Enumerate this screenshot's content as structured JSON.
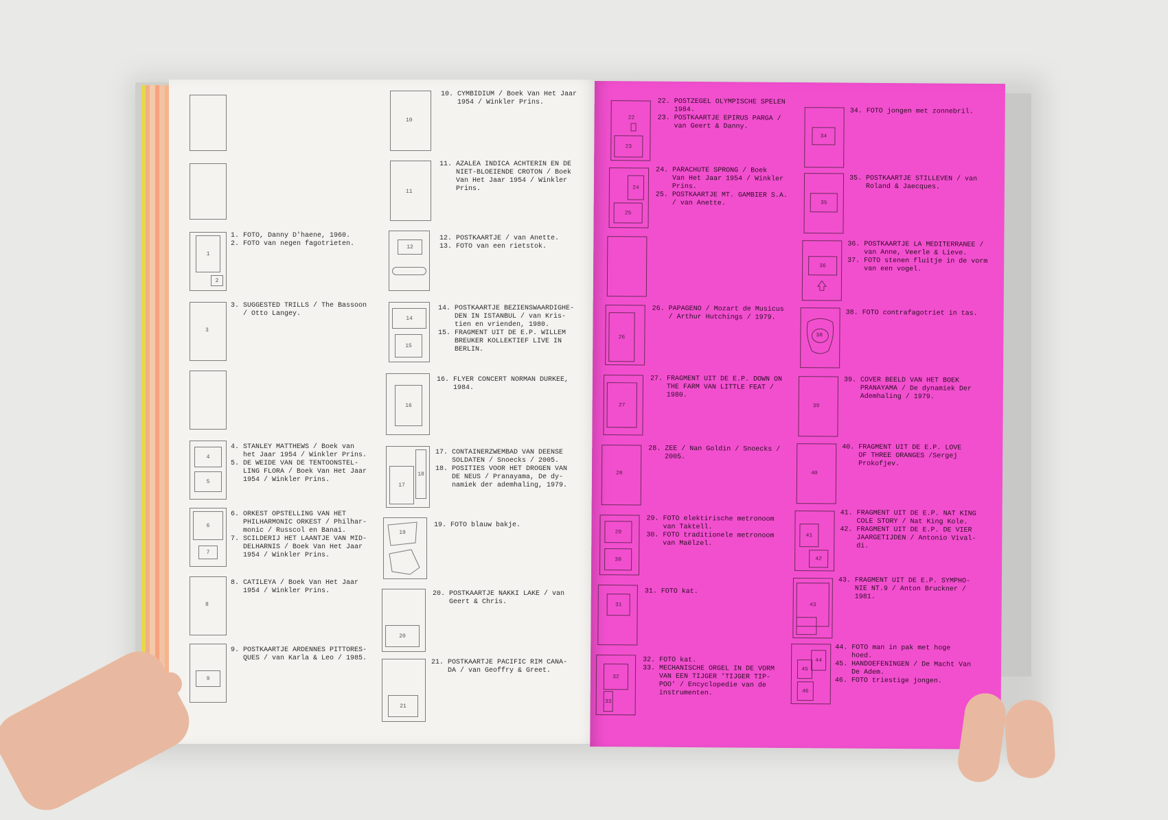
{
  "left_page": {
    "captions": {
      "c1": "1. FOTO, Danny D'haene, 1960.\n2. FOTO van negen fagotrieten.",
      "c3": "3. SUGGESTED TRILLS / The Bassoon\n   / Otto Langey.",
      "c4": "4. STANLEY MATTHEWS / Boek van\n   het Jaar 1954 / Winkler Prins.\n5. DE WEIDE VAN DE TENTOONSTEL-\n   LING FLORA / Boek Van Het Jaar\n   1954 / Winkler Prins.",
      "c6": "6. ORKEST OPSTELLING VAN HET\n   PHILHARMONIC ORKEST / Philhar-\n   monic / Russcol en Banai.\n7. SCILDERIJ HET LAANTJE VAN MID-\n   DELHARNIS / Boek Van Het Jaar\n   1954 / Winkler Prins.",
      "c8": "8. CATILEYA / Boek Van Het Jaar\n   1954 / Winkler Prins.",
      "c9": "9. POSTKAARTJE ARDENNES PITTORES-\n   QUES / van Karla & Leo / 1985.",
      "c10": "10. CYMBIDIUM / Boek Van Het Jaar\n    1954 / Winkler Prins.",
      "c11": "11. AZALEA INDICA ACHTERIN EN DE\n    NIET-BLOEIENDE CROTON / Boek\n    Van Het Jaar 1954 / Winkler\n    Prins.",
      "c12": "12. POSTKAARTJE / van Anette.\n13. FOTO van een rietstok.",
      "c14": "14. POSTKAARTJE BEZIENSWAARDIGHE-\n    DEN IN ISTANBUL / van Kris-\n    tien en vrienden, 1980.\n15. FRAGMENT UIT DE E.P. WILLEM\n    BREUKER KOLLEKTIEF LIVE IN\n    BERLIN.",
      "c16": "16. FLYER CONCERT NORMAN DURKEE,\n    1984.",
      "c17": "17. CONTAINERZWEMBAD VAN DEENSE\n    SOLDATEN / Snoecks / 2005.\n18. POSITIES VOOR HET DROGEN VAN\n    DE NEUS / Pranayama, De dy-\n    namiek der ademhaling, 1979.",
      "c19": "19. FOTO blauw bakje.",
      "c20": "20. POSTKAARTJE NAKKI LAKE / van\n    Geert & Chris.",
      "c21": "21. POSTKAARTJE PACIFIC RIM CANA-\n    DA / van Geoffry & Greet."
    },
    "numbers": {
      "n1": "1",
      "n2": "2",
      "n3": "3",
      "n4": "4",
      "n5": "5",
      "n6": "6",
      "n7": "7",
      "n8": "8",
      "n9": "9",
      "n10": "10",
      "n11": "11",
      "n12": "12",
      "n14": "14",
      "n15": "15",
      "n16": "16",
      "n17": "17",
      "n18": "18",
      "n19": "19",
      "n20": "20",
      "n21": "21"
    }
  },
  "right_page": {
    "background": "#f24fcf",
    "captions": {
      "c22": "22. POSTZEGEL OLYMPISCHE SPELEN\n    1984.\n23. POSTKAARTJE EPIRUS PARGA /\n    van Geert & Danny.",
      "c24": "24. PARACHUTE SPRONG / Boek\n    Van Het Jaar 1954 / Winkler\n    Prins.\n25. POSTKAARTJE MT. GAMBIER S.A.\n    / van Anette.",
      "c26": "26. PAPAGENO / Mozart de Musicus\n    / Arthur Hutchings / 1979.",
      "c27": "27. FRAGMENT UIT DE E.P. DOWN ON\n    THE FARM VAN LITTLE FEAT /\n    1980.",
      "c28": "28. ZEE / Nan Goldin / Snoecks /\n    2005.",
      "c29": "29. FOTO elektirische metronoom\n    van Taktell.\n30. FOTO traditionele metronoom\n    van Maëlzel.",
      "c31": "31. FOTO kat.",
      "c32": "32. FOTO kat.\n33. MECHANISCHE ORGEL IN DE VORM\n    VAN EEN TIJGER 'TIJGER TIP-\n    POO' / Encyclopedie van de\n    instrumenten.",
      "c34": "34. FOTO jongen met zonnebril.",
      "c35": "35. POSTKAARTJE STILLEVEN / van\n    Roland & Jaecques.",
      "c36": "36. POSTKAARTJE LA MEDITERRANEE /\n    van Anne, Veerle & Lieve.\n37. FOTO stenen fluitje in de vorm\n    van een vogel.",
      "c38": "38. FOTO contrafagotriet in tas.",
      "c39": "39. COVER BEELD VAN HET BOEK\n    PRANAYAMA / De dynamiek Der\n    Ademhaling / 1979.",
      "c40": "40. FRAGMENT UIT DE E.P. LOVE\n    OF THREE ORANGES /Sergej\n    Prokofjev.",
      "c41": "41. FRAGMENT UIT DE E.P. NAT KING\n    COLE STORY / Nat King Kole.\n42. FRAGMENT UIT DE E.P. DE VIER\n    JAARGETIJDEN / Antonio Vival-\n    di.",
      "c43": "43. FRAGMENT UIT DE E.P. SYMPHO-\n    NIE NT.9 / Anton Bruckner /\n    1981.",
      "c44": "44. FOTO man in pak met hoge\n    hoed.\n45. HANDOEFENINGEN / De Macht Van\n    De Adem.\n46. FOTO triestige jongen."
    },
    "numbers": {
      "n22": "22",
      "n23": "23",
      "n24": "24",
      "n25": "25",
      "n26": "26",
      "n27": "27",
      "n28": "28",
      "n29": "29",
      "n30": "30",
      "n31": "31",
      "n32": "32",
      "n33": "33",
      "n34": "34",
      "n35": "35",
      "n36": "36",
      "n38": "38",
      "n39": "39",
      "n40": "40",
      "n41": "41",
      "n42": "42",
      "n43": "43",
      "n44": "44",
      "n45": "45",
      "n46": "46"
    }
  }
}
